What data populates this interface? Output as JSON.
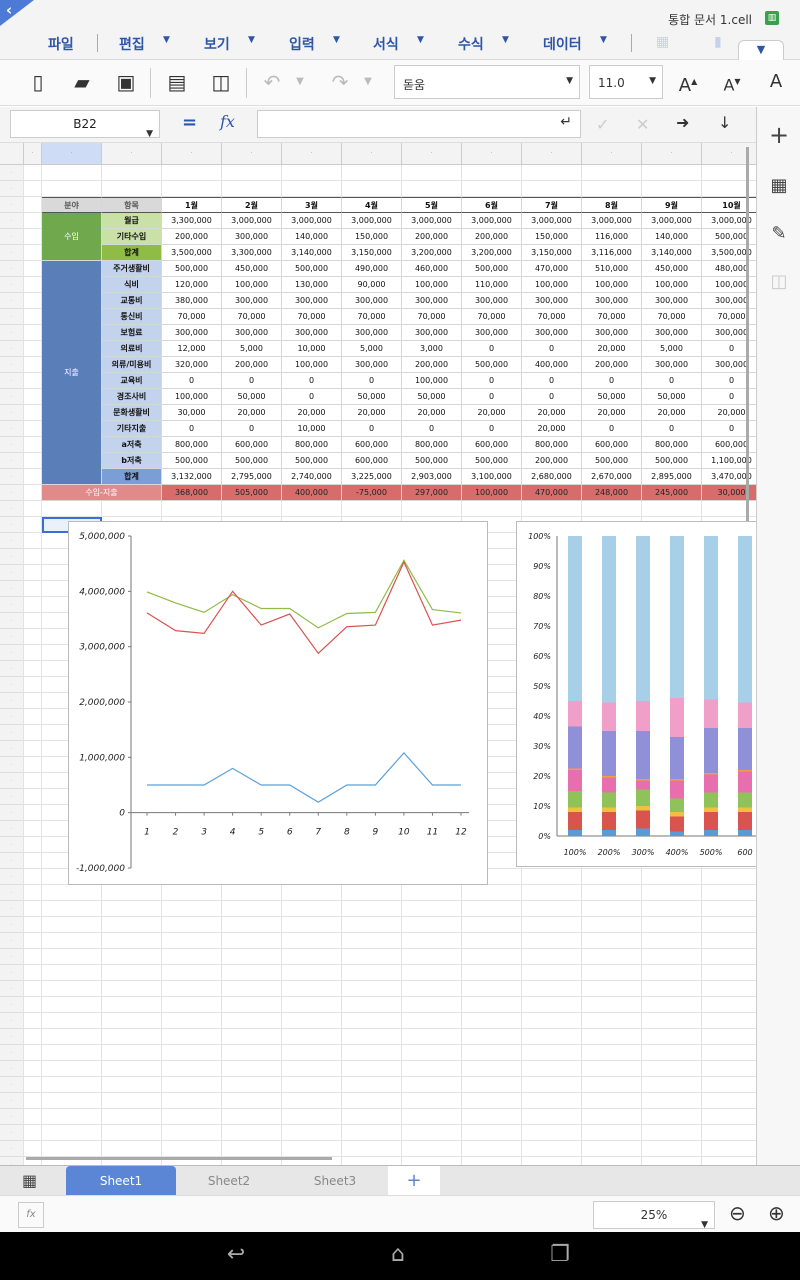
{
  "app": {
    "doc_title": "통합 문서 1.cell",
    "back_icon": "chevron-left-icon"
  },
  "menu": [
    {
      "label": "파일"
    },
    {
      "label": "편집"
    },
    {
      "label": "보기"
    },
    {
      "label": "입력"
    },
    {
      "label": "서식"
    },
    {
      "label": "수식"
    },
    {
      "label": "데이터"
    }
  ],
  "toolbar": {
    "font_name": "돋움",
    "font_size": "11.0"
  },
  "formula_bar": {
    "cell_ref": "B22",
    "equals": "=",
    "fx": "fx",
    "formula": ""
  },
  "table": {
    "headers": [
      "분야",
      "항목",
      "1월",
      "2월",
      "3월",
      "4월",
      "5월",
      "6월",
      "7월",
      "8월",
      "9월",
      "10월"
    ],
    "income_group": "수입",
    "expense_group": "지출",
    "income_rows": [
      {
        "item": "월급",
        "values": [
          "3,300,000",
          "3,000,000",
          "3,000,000",
          "3,000,000",
          "3,000,000",
          "3,000,000",
          "3,000,000",
          "3,000,000",
          "3,000,000",
          "3,000,000"
        ]
      },
      {
        "item": "기타수입",
        "values": [
          "200,000",
          "300,000",
          "140,000",
          "150,000",
          "200,000",
          "200,000",
          "150,000",
          "116,000",
          "140,000",
          "500,000"
        ]
      },
      {
        "item": "합계",
        "values": [
          "3,500,000",
          "3,300,000",
          "3,140,000",
          "3,150,000",
          "3,200,000",
          "3,200,000",
          "3,150,000",
          "3,116,000",
          "3,140,000",
          "3,500,000"
        ]
      }
    ],
    "expense_rows": [
      {
        "item": "주거생활비",
        "values": [
          "500,000",
          "450,000",
          "500,000",
          "490,000",
          "460,000",
          "500,000",
          "470,000",
          "510,000",
          "450,000",
          "480,000"
        ]
      },
      {
        "item": "식비",
        "values": [
          "120,000",
          "100,000",
          "130,000",
          "90,000",
          "100,000",
          "110,000",
          "100,000",
          "100,000",
          "100,000",
          "100,000"
        ]
      },
      {
        "item": "교통비",
        "values": [
          "380,000",
          "300,000",
          "300,000",
          "300,000",
          "300,000",
          "300,000",
          "300,000",
          "300,000",
          "300,000",
          "300,000"
        ]
      },
      {
        "item": "통신비",
        "values": [
          "70,000",
          "70,000",
          "70,000",
          "70,000",
          "70,000",
          "70,000",
          "70,000",
          "70,000",
          "70,000",
          "70,000"
        ]
      },
      {
        "item": "보험료",
        "values": [
          "300,000",
          "300,000",
          "300,000",
          "300,000",
          "300,000",
          "300,000",
          "300,000",
          "300,000",
          "300,000",
          "300,000"
        ]
      },
      {
        "item": "의료비",
        "values": [
          "12,000",
          "5,000",
          "10,000",
          "5,000",
          "3,000",
          "0",
          "0",
          "20,000",
          "5,000",
          "0"
        ]
      },
      {
        "item": "의류/미용비",
        "values": [
          "320,000",
          "200,000",
          "100,000",
          "300,000",
          "200,000",
          "500,000",
          "400,000",
          "200,000",
          "300,000",
          "300,000"
        ]
      },
      {
        "item": "교육비",
        "values": [
          "0",
          "0",
          "0",
          "0",
          "100,000",
          "0",
          "0",
          "0",
          "0",
          "0"
        ]
      },
      {
        "item": "경조사비",
        "values": [
          "100,000",
          "50,000",
          "0",
          "50,000",
          "50,000",
          "0",
          "0",
          "50,000",
          "50,000",
          "0"
        ]
      },
      {
        "item": "문화생활비",
        "values": [
          "30,000",
          "20,000",
          "20,000",
          "20,000",
          "20,000",
          "20,000",
          "20,000",
          "20,000",
          "20,000",
          "20,000"
        ]
      },
      {
        "item": "기타지출",
        "values": [
          "0",
          "0",
          "10,000",
          "0",
          "0",
          "0",
          "20,000",
          "0",
          "0",
          "0"
        ]
      },
      {
        "item": "a저축",
        "values": [
          "800,000",
          "600,000",
          "800,000",
          "600,000",
          "800,000",
          "600,000",
          "800,000",
          "600,000",
          "800,000",
          "600,000"
        ]
      },
      {
        "item": "b저축",
        "values": [
          "500,000",
          "500,000",
          "500,000",
          "600,000",
          "500,000",
          "500,000",
          "200,000",
          "500,000",
          "500,000",
          "1,100,000"
        ]
      },
      {
        "item": "합계",
        "values": [
          "3,132,000",
          "2,795,000",
          "2,740,000",
          "3,225,000",
          "2,903,000",
          "3,100,000",
          "2,680,000",
          "2,670,000",
          "2,895,000",
          "3,470,000"
        ]
      }
    ],
    "net_row": {
      "item": "수입-지출",
      "values": [
        "368,000",
        "505,000",
        "400,000",
        "-75,000",
        "297,000",
        "100,000",
        "470,000",
        "248,000",
        "245,000",
        "30,000"
      ]
    }
  },
  "chart_data": [
    {
      "type": "line",
      "x": [
        1,
        2,
        3,
        4,
        5,
        6,
        7,
        8,
        9,
        10,
        11,
        12
      ],
      "ylim": [
        -1000000,
        5000000
      ],
      "yticks": [
        "5,000,000",
        "4,000,000",
        "3,000,000",
        "2,000,000",
        "1,000,000",
        "0",
        "-1,000,000"
      ],
      "series": [
        {
          "color": "#8fbc45",
          "values": [
            3990000,
            3790000,
            3620000,
            3940000,
            3690000,
            3690000,
            3340000,
            3600000,
            3620000,
            4560000,
            3670000,
            3610000
          ]
        },
        {
          "color": "#d9534f",
          "values": [
            3610000,
            3290000,
            3240000,
            4000000,
            3390000,
            3590000,
            2880000,
            3360000,
            3390000,
            4530000,
            3390000,
            3480000
          ]
        },
        {
          "color": "#5aa0d8",
          "values": [
            500000,
            500000,
            500000,
            800000,
            500000,
            500000,
            190000,
            500000,
            500000,
            1080000,
            500000,
            500000
          ]
        }
      ],
      "grid": false
    },
    {
      "type": "bar",
      "stacked": "percent",
      "categories": [
        "100%",
        "200%",
        "300%",
        "400%",
        "500%",
        "600"
      ],
      "ylim": [
        0,
        100
      ],
      "yticks": [
        "100%",
        "90%",
        "80%",
        "70%",
        "60%",
        "50%",
        "40%",
        "30%",
        "20%",
        "10%",
        "0%"
      ],
      "series": [
        {
          "color": "#5b9bd5",
          "values": [
            2,
            2,
            2.5,
            1.5,
            2,
            2
          ]
        },
        {
          "color": "#d9534f",
          "values": [
            6,
            6,
            6,
            5,
            6,
            6
          ]
        },
        {
          "color": "#f0c040",
          "values": [
            1.5,
            1.5,
            1.5,
            1.5,
            1.5,
            1.5
          ]
        },
        {
          "color": "#8fc35a",
          "values": [
            5.5,
            5,
            5.5,
            4.5,
            5,
            5
          ]
        },
        {
          "color": "#e86fae",
          "values": [
            7,
            5,
            3,
            6,
            6,
            7
          ]
        },
        {
          "color": "#f0a040",
          "values": [
            0.5,
            0.5,
            0.5,
            0.5,
            0.5,
            0.5
          ]
        },
        {
          "color": "#9090d8",
          "values": [
            14,
            15,
            16,
            14,
            15,
            14
          ]
        },
        {
          "color": "#f0a0c8",
          "values": [
            8.5,
            9.5,
            10,
            13,
            9.5,
            8.5
          ]
        },
        {
          "color": "#a7cfe8",
          "values": [
            55,
            55.5,
            55,
            54,
            54.5,
            55.5
          ]
        }
      ]
    }
  ],
  "sheets": {
    "tabs": [
      "Sheet1",
      "Sheet2",
      "Sheet3"
    ],
    "active": "Sheet1",
    "add": "+"
  },
  "status": {
    "zoom": "25%"
  }
}
